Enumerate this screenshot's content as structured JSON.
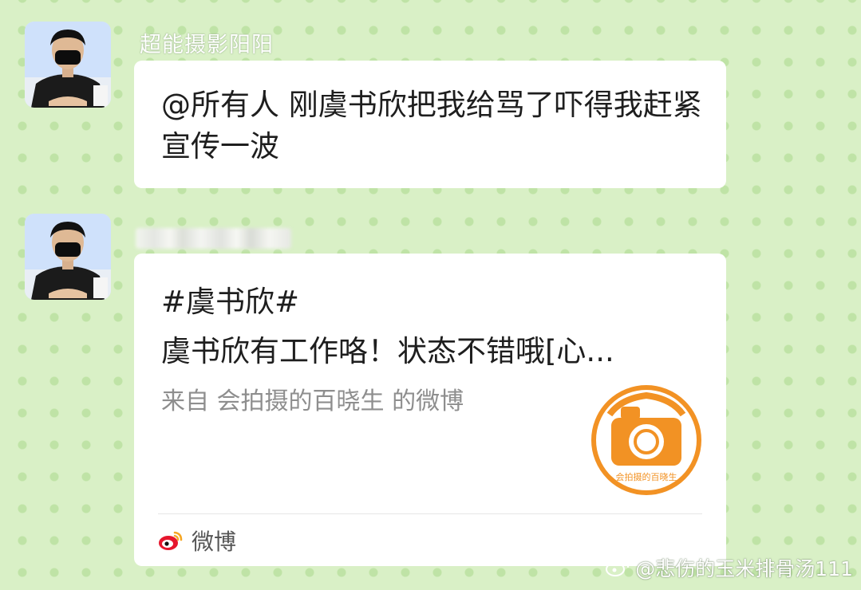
{
  "messages": [
    {
      "sender": "超能摄影阳阳",
      "text": "@所有人 刚虞书欣把我给骂了吓得我赶紧宣传一波"
    },
    {
      "sender_blurred": true,
      "card": {
        "title": "#虞书欣#",
        "body": "虞书欣有工作咯！状态不错哦[心...",
        "source": "来自 会拍摄的百晓生 的微博",
        "thumb_logo_text": "会拍摄的百晓生",
        "footer_app": "微博",
        "footer_icon": "weibo-icon"
      }
    }
  ],
  "watermark": {
    "text": "@悲伤的玉米排骨汤111",
    "icon": "weibo-icon"
  },
  "colors": {
    "background": "#d9f0c6",
    "dots": "#bfe3a6",
    "bubble": "#ffffff",
    "text": "#1e1e1e",
    "muted": "#8e8e8e",
    "logo_orange": "#f29224"
  }
}
